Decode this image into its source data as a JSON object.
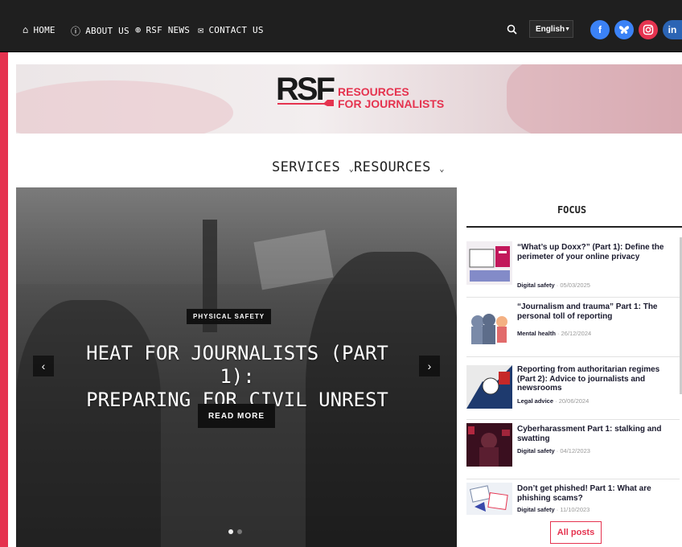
{
  "topnav": {
    "items": [
      {
        "icon": "home-icon",
        "glyph": "⌂",
        "label": "HOME"
      },
      {
        "icon": "info-icon",
        "glyph": "ⓘ",
        "label": "ABOUT US"
      },
      {
        "icon": "globe-icon",
        "glyph": "⊕",
        "label": "RSF NEWS"
      },
      {
        "icon": "mail-icon",
        "glyph": "✉",
        "label": "CONTACT US"
      }
    ],
    "search_glyph": "🔍",
    "language": "English",
    "social": [
      {
        "name": "facebook-icon",
        "glyph": "f",
        "color": "#3b82f6"
      },
      {
        "name": "bluesky-icon",
        "glyph": "🦋",
        "color": "#3b82f6"
      },
      {
        "name": "instagram-icon",
        "glyph": "◎",
        "color": "#e5334f"
      },
      {
        "name": "linkedin-icon",
        "glyph": "in",
        "color": "#2b64b4"
      }
    ]
  },
  "brand": {
    "mark": "RSF",
    "line1": "RESOURCES",
    "line2": "FOR JOURNALISTS",
    "accent": "#e5334f"
  },
  "menu": {
    "services": "SERVICES",
    "resources": "RESOURCES"
  },
  "hero": {
    "category": "PHYSICAL SAFETY",
    "title_line1": "HEAT FOR JOURNALISTS (PART 1):",
    "title_line2": "PREPARING FOR CIVIL UNREST",
    "read_more": "READ MORE",
    "slides": 2,
    "active_slide": 1
  },
  "focus": {
    "title": "FOCUS",
    "posts": [
      {
        "title": "“What’s up Doxx?” (Part 1): Define the perimeter of your online privacy",
        "category": "Digital safety",
        "date": "05/03/2025"
      },
      {
        "title": "“Journalism and trauma” Part 1: The personal toll of reporting",
        "category": "Mental health",
        "date": "26/12/2024"
      },
      {
        "title": "Reporting from authoritarian regimes (Part 2): Advice to journalists and newsrooms",
        "category": "Legal advice",
        "date": "20/06/2024"
      },
      {
        "title": "Cyberharassment Part 1: stalking and swatting",
        "category": "Digital safety",
        "date": "04/12/2023"
      },
      {
        "title": "Don’t get phished! Part 1: What are phishing scams?",
        "category": "Digital safety",
        "date": "11/10/2023"
      }
    ],
    "all_posts": "All posts"
  }
}
